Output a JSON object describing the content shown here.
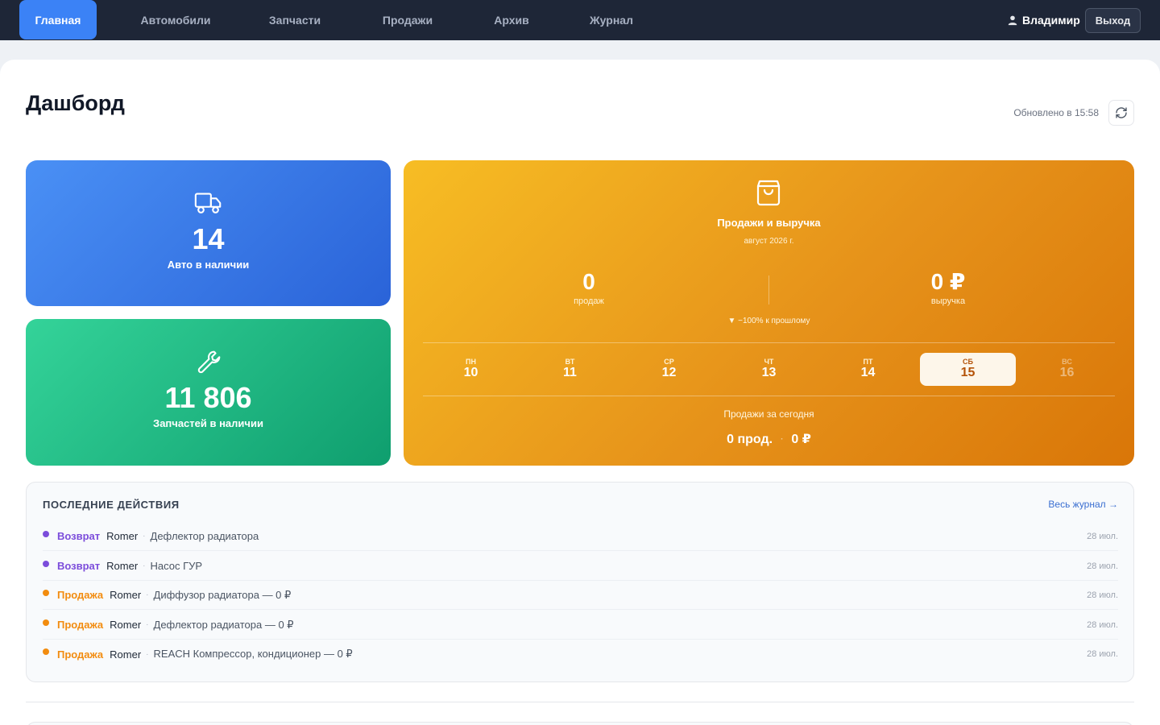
{
  "nav": {
    "tabs": [
      "Главная",
      "Автомобили",
      "Запчасти",
      "Продажи",
      "Архив",
      "Журнал"
    ],
    "active_tab": "Главная",
    "user_name": "Владимир",
    "logout_label": "Выход"
  },
  "page": {
    "title": "Дашборд",
    "updated": "Обновлено в 15:58"
  },
  "cars_card": {
    "value": "14",
    "label": "Авто в наличии",
    "icon": "truck-icon"
  },
  "parts_card": {
    "value": "11 806",
    "label": "Запчастей в наличии",
    "icon": "wrench-icon"
  },
  "sales_card": {
    "icon": "shopping-bag-icon",
    "title": "Продажи и выручка",
    "month": "август 2026 г.",
    "sales_count": "0",
    "sales_count_label": "продаж",
    "revenue": "0 ₽",
    "revenue_label": "выручка",
    "trend": "▼ −100% к прошлому",
    "week": [
      {
        "dow": "ПН",
        "num": "10"
      },
      {
        "dow": "ВТ",
        "num": "11"
      },
      {
        "dow": "СР",
        "num": "12"
      },
      {
        "dow": "ЧТ",
        "num": "13"
      },
      {
        "dow": "ПТ",
        "num": "14"
      },
      {
        "dow": "СБ",
        "num": "15"
      },
      {
        "dow": "ВС",
        "num": "16"
      }
    ],
    "today_index": 5,
    "today_title": "Продажи за сегодня",
    "today_sales": "0 прод.",
    "today_sep": "·",
    "today_revenue": "0 ₽"
  },
  "recent": {
    "title": "ПОСЛЕДНИЕ ДЕЙСТВИЯ",
    "link": "Весь журнал →",
    "sep": "·",
    "items": [
      {
        "type": "Возврат",
        "kind": "return",
        "user": "Romer",
        "text": "Дефлектор радиатора",
        "date": "28 июл."
      },
      {
        "type": "Возврат",
        "kind": "return",
        "user": "Romer",
        "text": "Насос ГУР",
        "date": "28 июл."
      },
      {
        "type": "Продажа",
        "kind": "sale",
        "user": "Romer",
        "text": "Диффузор радиатора — 0 ₽",
        "date": "28 июл."
      },
      {
        "type": "Продажа",
        "kind": "sale",
        "user": "Romer",
        "text": "Дефлектор радиатора — 0 ₽",
        "date": "28 июл."
      },
      {
        "type": "Продажа",
        "kind": "sale",
        "user": "Romer",
        "text": "REACH Компрессор, кондиционер — 0 ₽",
        "date": "28 июл."
      }
    ],
    "colors": {
      "return": "#7c4ddb",
      "sale": "#f28c0f"
    }
  }
}
